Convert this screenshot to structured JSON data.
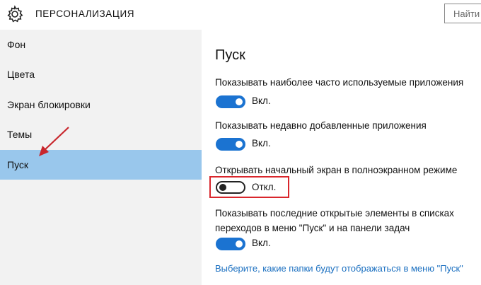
{
  "header": {
    "title": "ПЕРСОНАЛИЗАЦИЯ",
    "search_placeholder": "Найти",
    "icon": "gear-icon"
  },
  "sidebar": {
    "items": [
      {
        "label": "Фон",
        "active": false
      },
      {
        "label": "Цвета",
        "active": false
      },
      {
        "label": "Экран блокировки",
        "active": false
      },
      {
        "label": "Темы",
        "active": false
      },
      {
        "label": "Пуск",
        "active": true
      }
    ],
    "active_color": "#99c7ec",
    "arrow_color": "#c8262c"
  },
  "main": {
    "title": "Пуск",
    "settings": [
      {
        "label": "Показывать наиболее часто используемые приложения",
        "state": "Вкл.",
        "on": true
      },
      {
        "label": "Показывать недавно добавленные приложения",
        "state": "Вкл.",
        "on": true
      },
      {
        "label": "Открывать начальный экран в полноэкранном режиме",
        "state": "Откл.",
        "on": false
      },
      {
        "label": "Показывать последние открытые элементы в списках переходов в меню \"Пуск\" и на панели задач",
        "state": "Вкл.",
        "on": true
      }
    ],
    "link": "Выберите, какие папки будут отображаться в меню \"Пуск\"",
    "accent_color": "#1b73d1",
    "link_color": "#1a6fc0",
    "highlight_color": "#d9262c"
  }
}
